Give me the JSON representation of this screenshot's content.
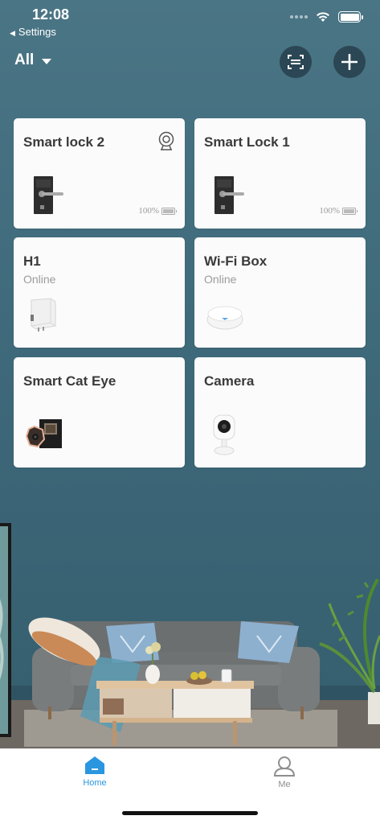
{
  "status_bar": {
    "time": "12:08",
    "back_label": "Settings"
  },
  "header": {
    "filter_label": "All"
  },
  "devices": [
    {
      "name": "Smart lock 2",
      "status": "",
      "battery": "100%"
    },
    {
      "name": "Smart Lock 1",
      "status": "",
      "battery": "100%"
    },
    {
      "name": "H1",
      "status": "Online",
      "battery": ""
    },
    {
      "name": "Wi-Fi Box",
      "status": "Online",
      "battery": ""
    },
    {
      "name": "Smart Cat Eye",
      "status": "",
      "battery": ""
    },
    {
      "name": "Camera",
      "status": "",
      "battery": ""
    }
  ],
  "tabs": {
    "home": "Home",
    "me": "Me"
  },
  "colors": {
    "accent": "#2a96e0",
    "card": "#fbfbfb",
    "background": "#3e6b7c"
  }
}
